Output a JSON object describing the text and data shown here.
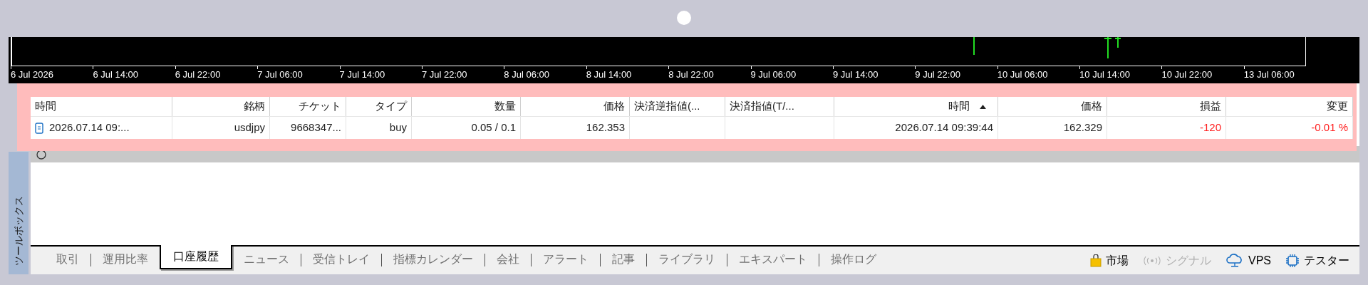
{
  "chart": {
    "axis_labels": [
      "6 Jul 2026",
      "6 Jul 14:00",
      "6 Jul 22:00",
      "7 Jul 06:00",
      "7 Jul 14:00",
      "7 Jul 22:00",
      "8 Jul 06:00",
      "8 Jul 14:00",
      "8 Jul 22:00",
      "9 Jul 06:00",
      "9 Jul 14:00",
      "9 Jul 22:00",
      "10 Jul 06:00",
      "10 Jul 14:00",
      "10 Jul 22:00",
      "13 Jul 06:00"
    ]
  },
  "table": {
    "columns": [
      {
        "label": "時間",
        "sorted": false
      },
      {
        "label": "銘柄",
        "sorted": false
      },
      {
        "label": "チケット",
        "sorted": false
      },
      {
        "label": "タイプ",
        "sorted": false
      },
      {
        "label": "数量",
        "sorted": false
      },
      {
        "label": "価格",
        "sorted": false
      },
      {
        "label": "決済逆指値(...",
        "sorted": false
      },
      {
        "label": "決済指値(T/...",
        "sorted": false
      },
      {
        "label": "時間",
        "sorted": true
      },
      {
        "label": "価格",
        "sorted": false
      },
      {
        "label": "損益",
        "sorted": false
      },
      {
        "label": "変更",
        "sorted": false
      }
    ],
    "rows": [
      {
        "loss": true,
        "cells": [
          "2026.07.14 09:...",
          "usdjpy",
          "9668347...",
          "buy",
          "0.05 / 0.1",
          "162.353",
          "",
          "",
          "2026.07.14 09:39:44",
          "162.329",
          "-120",
          "-0.01 %"
        ]
      }
    ]
  },
  "toolbox_label": "ツールボックス",
  "tabs": [
    {
      "label": "取引",
      "selected": false
    },
    {
      "label": "運用比率",
      "selected": false
    },
    {
      "label": "口座履歴",
      "selected": true
    },
    {
      "label": "ニュース",
      "selected": false
    },
    {
      "label": "受信トレイ",
      "selected": false
    },
    {
      "label": "指標カレンダー",
      "selected": false
    },
    {
      "label": "会社",
      "selected": false
    },
    {
      "label": "アラート",
      "selected": false
    },
    {
      "label": "記事",
      "selected": false
    },
    {
      "label": "ライブラリ",
      "selected": false
    },
    {
      "label": "エキスパート",
      "selected": false
    },
    {
      "label": "操作ログ",
      "selected": false
    }
  ],
  "status_items": [
    {
      "kind": "market",
      "label": "市場",
      "disabled": false
    },
    {
      "kind": "signal",
      "label": "シグナル",
      "disabled": true
    },
    {
      "kind": "vps",
      "label": "VPS",
      "disabled": false
    },
    {
      "kind": "tester",
      "label": "テスター",
      "disabled": false
    }
  ]
}
